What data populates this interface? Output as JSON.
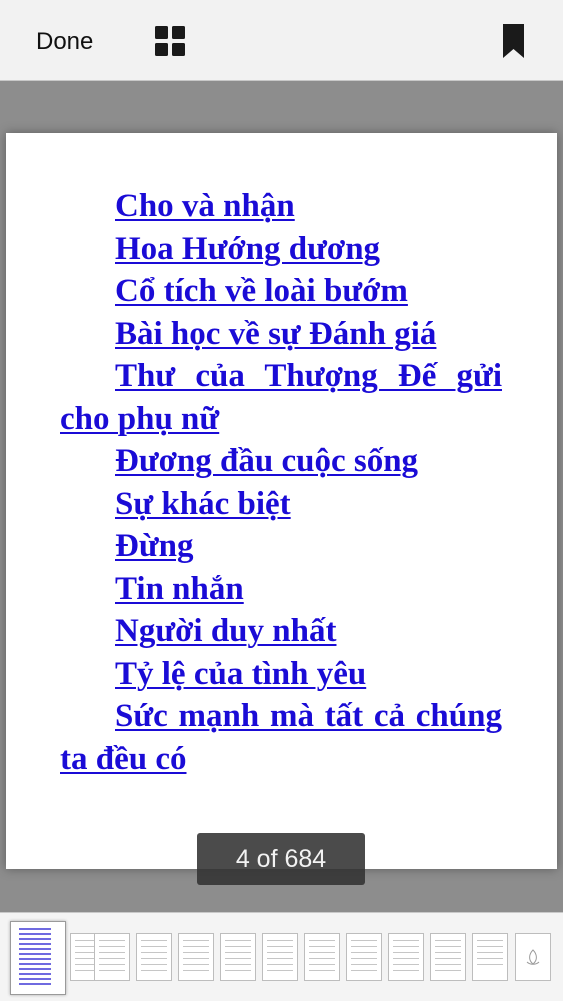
{
  "toolbar": {
    "done_label": "Done",
    "grid_icon": "grid-icon",
    "bookmark_icon": "bookmark-icon"
  },
  "page": {
    "toc_links": [
      "Cho và nhận",
      "Hoa Hướng dương",
      "Cổ tích về loài bướm",
      "Bài học về sự Đánh giá",
      "Thư của Thượng Đế gửi cho phụ nữ",
      "Đương đầu cuộc sống",
      "Sự khác biệt",
      "Đừng",
      "Tin nhắn",
      "Người duy nhất",
      "Tỷ lệ của tình yêu",
      "Sức mạnh mà tất cả chúng ta đều có"
    ],
    "link_color": "#1a0bd6"
  },
  "page_indicator": "4 of 684",
  "colors": {
    "toolbar_bg": "#f2f2f2",
    "viewer_bg": "#8d8d8d",
    "indicator_bg": "#323232"
  }
}
